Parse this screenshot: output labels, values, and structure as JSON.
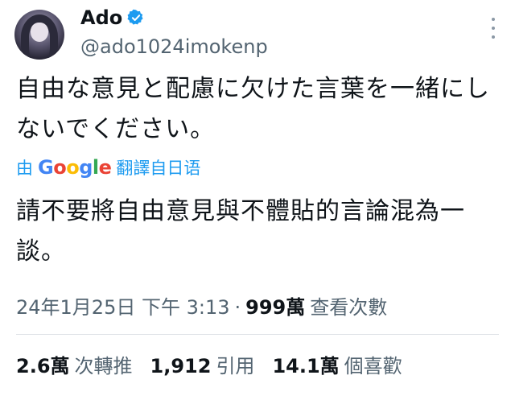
{
  "author": {
    "display_name": "Ado",
    "handle": "@ado1024imokenp",
    "verified": true
  },
  "tweet": {
    "text": "自由な意見と配慮に欠けた言葉を一緒にしないでください。"
  },
  "translation": {
    "prefix": "由",
    "provider": "Google",
    "suffix": "翻譯自日语",
    "text": "請不要將自由意見與不體貼的言論混為一談。"
  },
  "meta": {
    "timestamp": "24年1月25日 下午 3:13",
    "separator": "·",
    "views": "999萬",
    "views_label": "查看次數"
  },
  "stats": {
    "retweets": "2.6萬",
    "retweets_label": "次轉推",
    "quotes": "1,912",
    "quotes_label": "引用",
    "likes": "14.1萬",
    "likes_label": "個喜歡"
  },
  "colors": {
    "accent": "#1d9bf0",
    "secondary_text": "#536471"
  },
  "icons": {
    "verified": "verified-badge-icon",
    "more": "more-vertical-icon"
  }
}
